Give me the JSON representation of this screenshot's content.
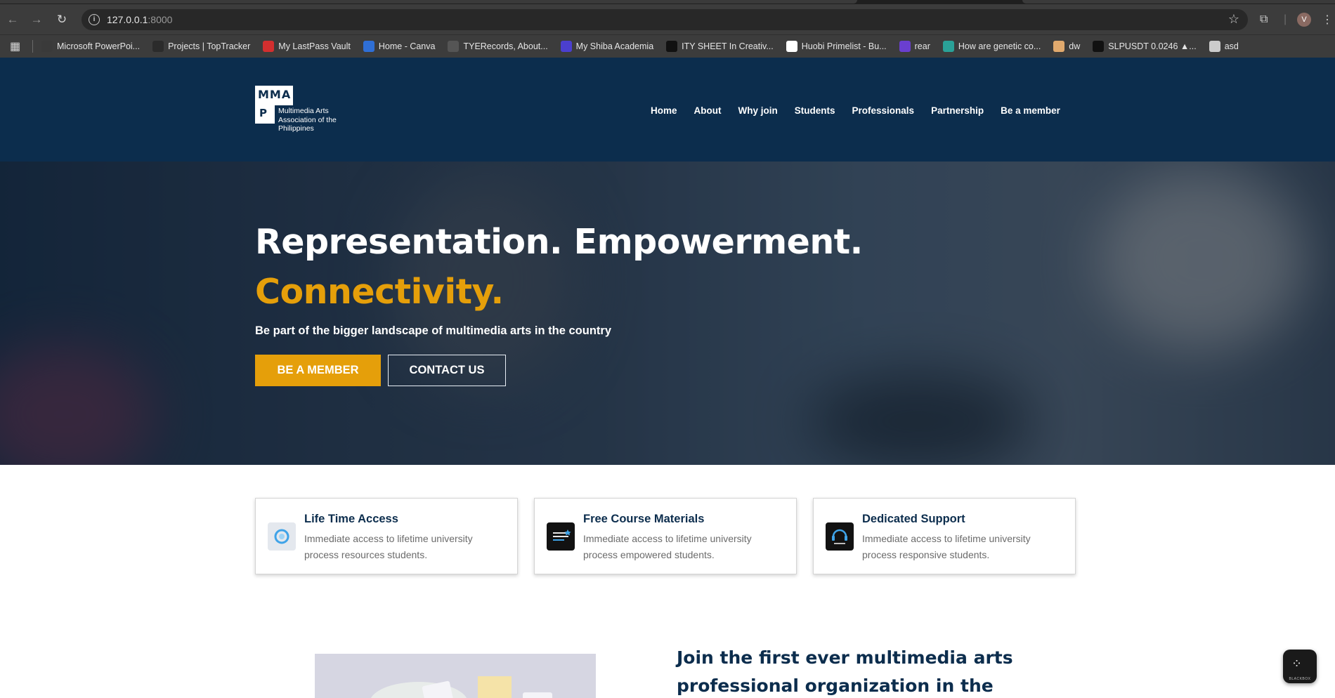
{
  "browser": {
    "url_host": "127.0.0.1",
    "url_port": ":8000",
    "profile_initial": "V",
    "bookmarks": [
      {
        "label": "Microsoft PowerPoi...",
        "color": "#3a3a3a"
      },
      {
        "label": "Projects | TopTracker",
        "color": "#2b2b2b"
      },
      {
        "label": "My LastPass Vault",
        "color": "#d32f2f"
      },
      {
        "label": "Home - Canva",
        "color": "#2f6fd6"
      },
      {
        "label": "TYERecords, About...",
        "color": "#555555"
      },
      {
        "label": "My Shiba Academia",
        "color": "#4b3fcf"
      },
      {
        "label": "ITY SHEET In Creativ...",
        "color": "#111111"
      },
      {
        "label": "Huobi Primelist - Bu...",
        "color": "#ffffff"
      },
      {
        "label": "rear",
        "color": "#6a3fd0"
      },
      {
        "label": "How are genetic co...",
        "color": "#2aa198"
      },
      {
        "label": "dw",
        "color": "#e0a96d"
      },
      {
        "label": "SLPUSDT 0.0246 ▲...",
        "color": "#111111"
      },
      {
        "label": "asd",
        "color": "#cccccc"
      }
    ]
  },
  "site": {
    "logo_letters_top": "MMA",
    "logo_letters_bottom": "P",
    "logo_text": "Multimedia Arts Association of the Philippines",
    "nav": [
      "Home",
      "About",
      "Why join",
      "Students",
      "Professionals",
      "Partnership",
      "Be a member"
    ]
  },
  "hero": {
    "title_line1": "Representation. Empowerment.",
    "title_line2": "Connectivity.",
    "subtitle": "Be part of the bigger landscape of multimedia arts in the country",
    "primary_button": "BE A MEMBER",
    "secondary_button": "CONTACT US"
  },
  "features": [
    {
      "title": "Life Time Access",
      "desc": "Immediate access to lifetime university process resources students.",
      "icon": "lifetime-access-icon",
      "icon_bg": "#e4e8ee"
    },
    {
      "title": "Free Course Materials",
      "desc": "Immediate access to lifetime university process empowered students.",
      "icon": "course-materials-icon",
      "icon_bg": "#121212"
    },
    {
      "title": "Dedicated Support",
      "desc": "Immediate access to lifetime university process responsive students.",
      "icon": "support-icon",
      "icon_bg": "#121212"
    }
  ],
  "join": {
    "title": "Join the first ever multimedia arts professional organization in the"
  },
  "floating_widget": {
    "label": "BLACKBOX"
  },
  "colors": {
    "brand_navy": "#0c2d4d",
    "accent_gold": "#e59f0a"
  }
}
